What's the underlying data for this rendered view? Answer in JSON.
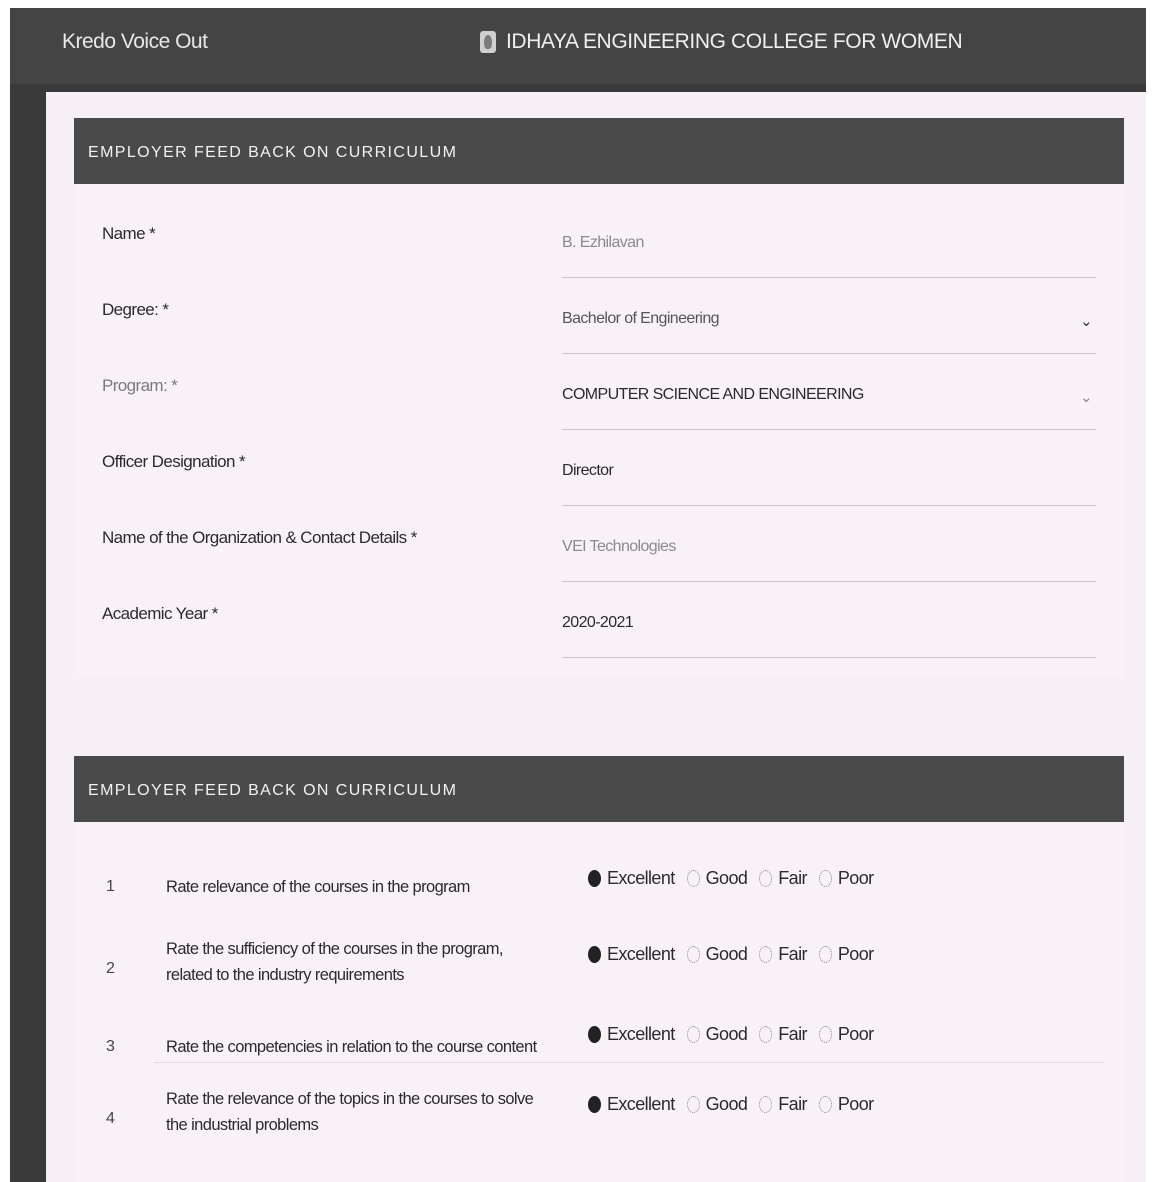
{
  "header": {
    "app_name": "Kredo Voice Out",
    "college_name": "IDHAYA ENGINEERING COLLEGE FOR WOMEN"
  },
  "form_section": {
    "title": "EMPLOYER FEED BACK ON CURRICULUM",
    "fields": [
      {
        "label": "Name *",
        "value": "B. Ezhilavan",
        "type": "text"
      },
      {
        "label": "Degree: *",
        "value": "Bachelor of Engineering",
        "type": "select"
      },
      {
        "label": "Program: *",
        "value": "COMPUTER SCIENCE AND ENGINEERING",
        "type": "select"
      },
      {
        "label": "Officer Designation *",
        "value": "Director",
        "type": "text"
      },
      {
        "label": "Name of the Organization & Contact Details *",
        "value": "VEI Technologies",
        "type": "text"
      },
      {
        "label": "Academic Year *",
        "value": "2020-2021",
        "type": "text"
      }
    ]
  },
  "feedback_section": {
    "title": "EMPLOYER FEED BACK ON CURRICULUM",
    "options": [
      "Excellent",
      "Good",
      "Fair",
      "Poor"
    ],
    "questions": [
      {
        "num": "1",
        "text": "Rate relevance of the courses in the program",
        "selected": "Excellent"
      },
      {
        "num": "2",
        "text": "Rate the sufficiency of the courses in the program, related to the industry requirements",
        "selected": "Excellent"
      },
      {
        "num": "3",
        "text": "Rate the competencies in relation to the course content",
        "selected": "Excellent"
      },
      {
        "num": "4",
        "text": "Rate the relevance of the topics in the courses to solve the industrial problems",
        "selected": "Excellent"
      }
    ]
  },
  "icons": {
    "logo": "college-logo-icon",
    "dropdown": "chevron-down-icon",
    "radio_selected": "radio-selected-icon",
    "radio_unselected": "radio-unselected-icon"
  },
  "colors": {
    "topbar": "#444444",
    "section_header": "#4a4a4a",
    "page_background": "#f6f0f6"
  }
}
